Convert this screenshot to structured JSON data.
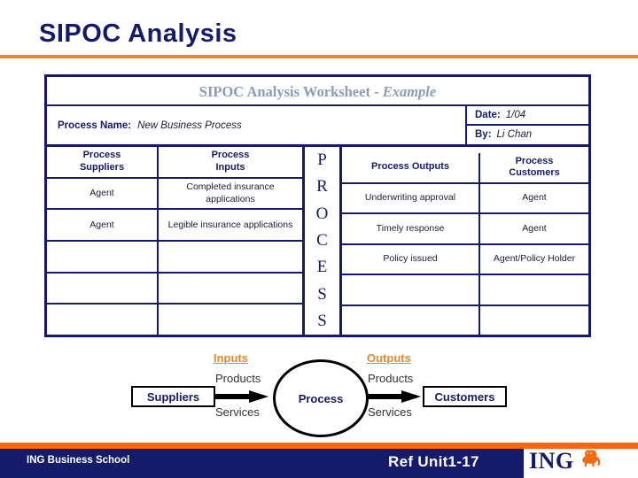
{
  "slide": {
    "title": "SIPOC Analysis"
  },
  "worksheet": {
    "title_main": "SIPOC Analysis Worksheet - ",
    "title_example": "Example",
    "process_name_label": "Process Name:",
    "process_name_value": "New Business Process",
    "date_label": "Date:",
    "date_value": "1/04",
    "by_label": "By:",
    "by_value": "Li Chan",
    "middle_column_letters": [
      "P",
      "R",
      "O",
      "C",
      "E",
      "S",
      "S"
    ],
    "columns": {
      "suppliers_header": "Process\nSuppliers",
      "suppliers_header_line1": "Process",
      "suppliers_header_line2": "Suppliers",
      "inputs_header_line1": "Process",
      "inputs_header_line2": "Inputs",
      "outputs_header": "Process Outputs",
      "customers_header_line1": "Process",
      "customers_header_line2": "Customers"
    },
    "suppliers": [
      "Agent",
      "Agent",
      "",
      "",
      ""
    ],
    "inputs": [
      "Completed insurance applications",
      "Legible insurance applications",
      "",
      "",
      ""
    ],
    "outputs": [
      "Underwriting approval",
      "Timely response",
      "Policy issued",
      "",
      ""
    ],
    "customers": [
      "Agent",
      "Agent",
      "Agent/Policy Holder",
      "",
      ""
    ]
  },
  "diagram": {
    "suppliers_box": "Suppliers",
    "customers_box": "Customers",
    "process_circle": "Process",
    "inputs_label": "Inputs",
    "outputs_label": "Outputs",
    "inputs_products": "Products",
    "inputs_services": "Services",
    "outputs_products": "Products",
    "outputs_services": "Services"
  },
  "footer": {
    "left_text": "ING Business School",
    "reference": "Ref Unit1-17",
    "logo_text": "ING"
  },
  "colors": {
    "navy": "#151B69",
    "orange": "#E08A2E",
    "orange_bright": "#F36A12",
    "worksheet_title_gray": "#8E9BB5"
  }
}
